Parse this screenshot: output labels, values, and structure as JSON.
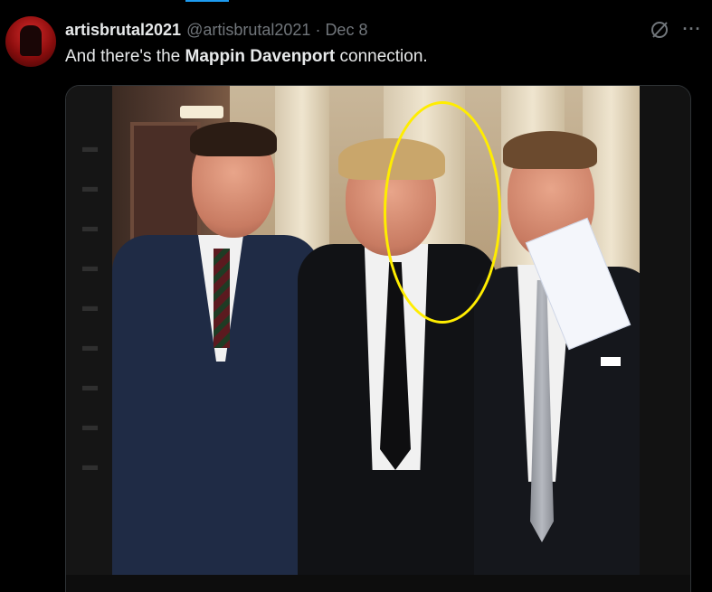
{
  "post": {
    "display_name": "artisbrutal2021",
    "handle": "@artisbrutal2021",
    "separator": "·",
    "date": "Dec 8",
    "text_before": "And there's the ",
    "text_bold": "Mappin Davenport",
    "text_after": " connection."
  },
  "icons": {
    "avatar": "avatar-image",
    "grok": "grok-icon",
    "more": "more-icon"
  },
  "colors": {
    "background": "#000000",
    "text_primary": "#e7e9ea",
    "text_secondary": "#71767b",
    "accent": "#1d9bf0",
    "highlight_circle": "#ffed00"
  }
}
